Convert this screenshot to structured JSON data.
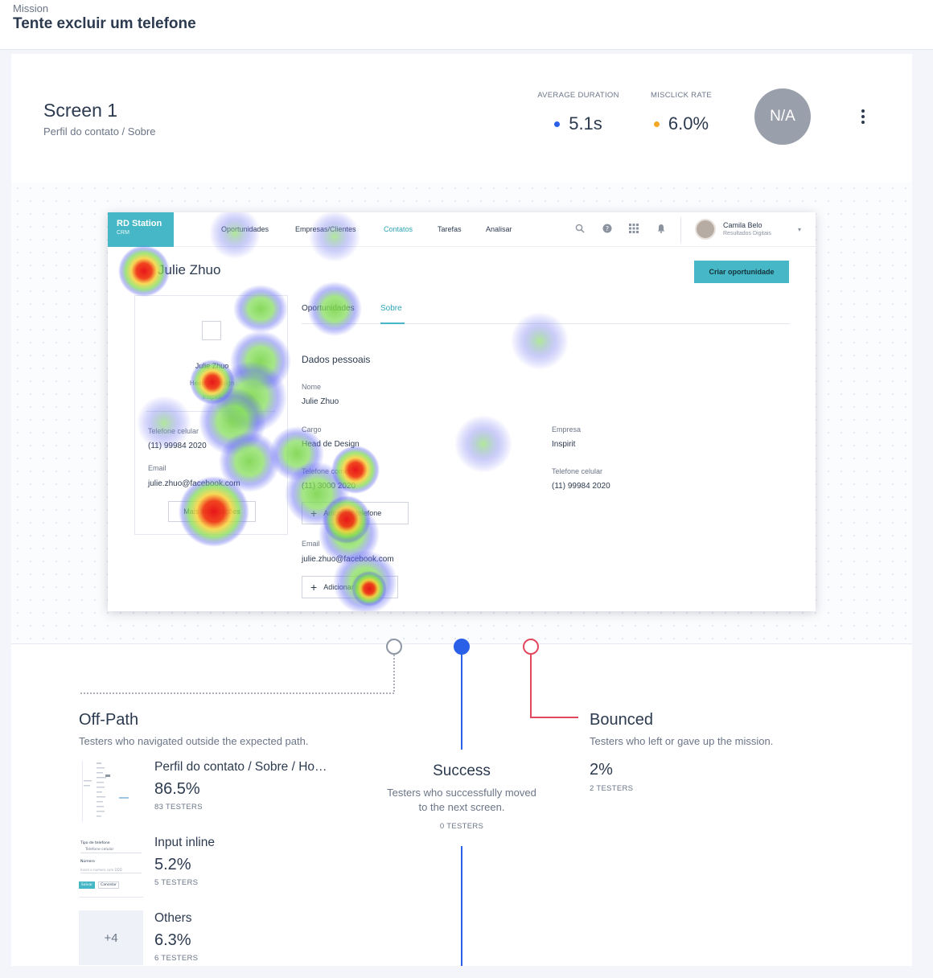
{
  "mission": {
    "label": "Mission",
    "title": "Tente excluir um telefone"
  },
  "screen": {
    "name": "Screen 1",
    "path": "Perfil do contato / Sobre",
    "metrics": {
      "duration_label": "AVERAGE DURATION",
      "duration_value": "5.1s",
      "duration_color": "#2a5fe8",
      "misclick_label": "MISCLICK RATE",
      "misclick_value": "6.0%",
      "misclick_color": "#f5a623"
    },
    "score_badge": "N/A",
    "menu_icon": "kebab-icon"
  },
  "shot": {
    "logo_title": "RD Station",
    "logo_sub": "CRM",
    "nav": [
      "Oportunidades",
      "Empresas/Clientes",
      "Contatos",
      "Tarefas",
      "Analisar"
    ],
    "nav_active": "Contatos",
    "icons": [
      "search-icon",
      "help-icon",
      "apps-grid-icon",
      "bell-icon"
    ],
    "user_name": "Camila Belo",
    "user_org": "Resultados Digitais",
    "profile_name": "Julie Zhuo",
    "cta": "Criar oportunidade",
    "card": {
      "name": "Julie Zhuo",
      "role": "Head of Design",
      "company": "Inspirit",
      "phone_label": "Telefone celular",
      "phone_value": "(11) 99984 2020",
      "email_label": "Email",
      "email_value": "julie.zhuo@facebook.com",
      "more_button": "Mais informações"
    },
    "tabs": [
      "Oportunidades",
      "Sobre"
    ],
    "section_title": "Dados pessoais",
    "fields": {
      "nome_label": "Nome",
      "nome_value": "Julie Zhuo",
      "cargo_label": "Cargo",
      "cargo_value": "Head de Design",
      "empresa_label": "Empresa",
      "empresa_value": "Inspirit",
      "tel_comercial_label": "Telefone comercial",
      "tel_comercial_value": "(11) 3000 2020",
      "tel_celular_label": "Telefone celular",
      "tel_celular_value": "(11) 99984 2020",
      "email_label": "Email",
      "email_value": "julie.zhuo@facebook.com"
    },
    "add_phone": "Adicionar telefone",
    "add_email": "Adicionar email"
  },
  "paths": {
    "off_path": {
      "title": "Off-Path",
      "desc": "Testers who navigated outside the expected path.",
      "color": "#8f96a3",
      "destinations": [
        {
          "name": "Perfil do contato / Sobre / Ho…",
          "pct": "86.5%",
          "testers": "83 TESTERS"
        },
        {
          "name": "Input inline",
          "pct": "5.2%",
          "testers": "5 TESTERS"
        },
        {
          "name": "Others",
          "pct": "6.3%",
          "testers": "6 TESTERS",
          "tile": "+4"
        }
      ]
    },
    "success": {
      "title": "Success",
      "desc_line1": "Testers who successfully moved",
      "desc_line2": "to the next screen.",
      "testers": "0 TESTERS",
      "color": "#2a5fe8"
    },
    "bounced": {
      "title": "Bounced",
      "desc": "Testers who left or gave up the mission.",
      "pct": "2%",
      "testers": "2 TESTERS",
      "color": "#e0485d"
    }
  },
  "thumb2": {
    "label_tipo": "Tipo de telefone",
    "select_value": "Telefone celular",
    "label_numero": "Número",
    "placeholder": "Insira o número com DDD",
    "save": "Salvar",
    "cancel": "Cancelar"
  }
}
